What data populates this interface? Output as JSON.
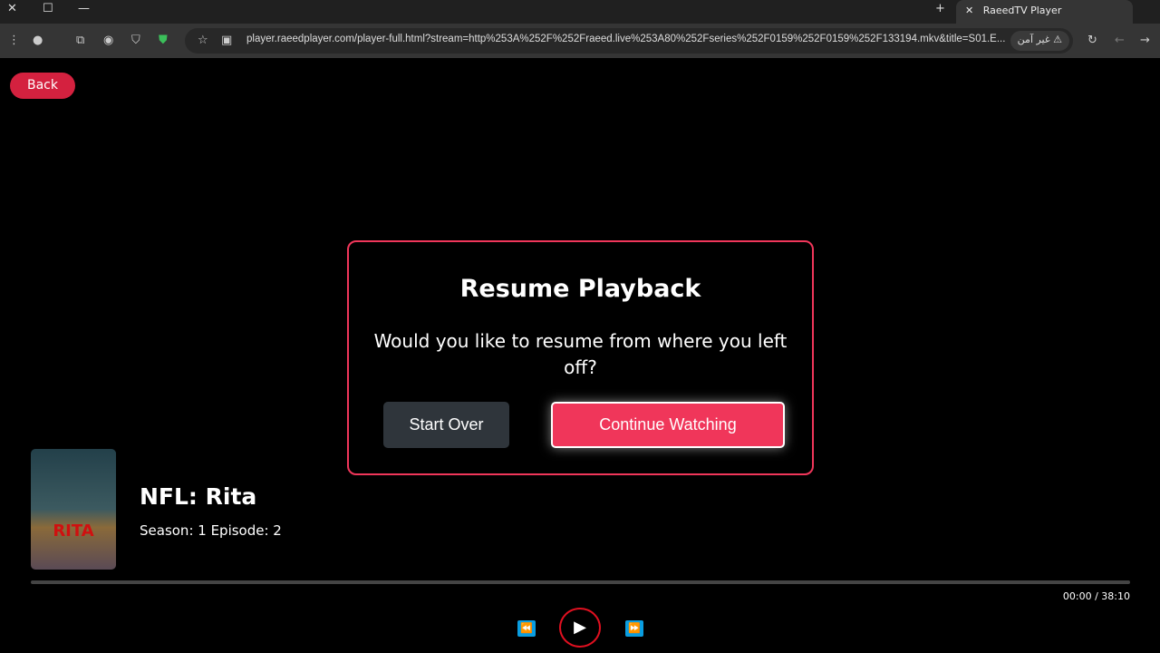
{
  "browser": {
    "tab_title": "RaeedTV Player",
    "url": "player.raeedplayer.com/player-full.html?stream=http%253A%252F%252Fraeed.live%253A80%252Fseries%252F0159%252F0159%252F133194.mkv&title=S01.E...",
    "security_label": "غير آمن"
  },
  "page": {
    "back_label": "Back"
  },
  "dialog": {
    "title": "Resume Playback",
    "message": "Would you like to resume from where you left off?",
    "start_over": "Start Over",
    "continue": "Continue Watching"
  },
  "media": {
    "poster_text": "RITA",
    "title": "NFL: Rita",
    "subtitle": "Season: 1 Episode: 2",
    "time": "00:00 / 38:10",
    "progress_percent": 0
  },
  "colors": {
    "accent": "#f0365a",
    "control_blue": "#0a9de0"
  }
}
